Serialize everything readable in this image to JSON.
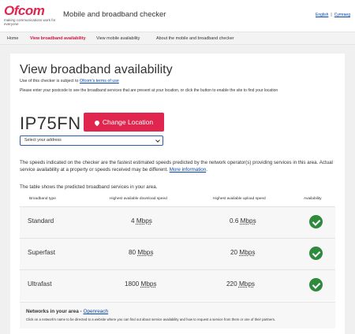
{
  "header": {
    "logo_word": "Ofcom",
    "logo_tagline": "making communications work for everyone",
    "site_title": "Mobile and broadband checker",
    "lang_english": "English",
    "lang_welsh": "Cymraeg",
    "lang_separator": "|"
  },
  "nav": {
    "items": [
      {
        "label": "Home"
      },
      {
        "label": "View broadband availability"
      },
      {
        "label": "View mobile availability"
      },
      {
        "label": "About the mobile and broadband checker"
      }
    ]
  },
  "main": {
    "title": "View broadband availability",
    "terms_prefix": "Use of this checker is subject to",
    "terms_link": "Ofcom's terms of use",
    "instructions": "Please enter your postcode to see the broadband services that are present at your location, or click the button to enable the site to find your location",
    "postcode": "IP75FN",
    "change_location_label": "Change Location",
    "address_select": {
      "selected": "Select your address"
    },
    "note_text": "The speeds indicated on the checker are the fastest estimated speeds predicted by the network operator(s) providing services in this area. Actual service availability at a property or speeds received may be different.",
    "note_link": "More information",
    "table_intro": "The table shows the predicted broadband services in your area.",
    "table": {
      "headers": [
        "Broadband type",
        "Highest available download speed",
        "Highest available upload speed",
        "Availability"
      ],
      "rows": [
        {
          "type": "Standard",
          "download_value": "4",
          "download_unit": "Mbps",
          "upload_value": "0.6",
          "upload_unit": "Mbps",
          "available": true
        },
        {
          "type": "Superfast",
          "download_value": "80",
          "download_unit": "Mbps",
          "upload_value": "20",
          "upload_unit": "Mbps",
          "available": true
        },
        {
          "type": "Ultrafast",
          "download_value": "1800",
          "download_unit": "Mbps",
          "upload_value": "220",
          "upload_unit": "Mbps",
          "available": true
        }
      ]
    },
    "networks": {
      "title": "Networks in your area -",
      "operator": "Openreach",
      "description": "Click on a network's name to be directed to a website where you can find out about service availability and how to request a service from them or one of their partners."
    }
  },
  "colors": {
    "brand": "#e0254f",
    "available": "#2e8b3d",
    "link": "#0645ad"
  }
}
